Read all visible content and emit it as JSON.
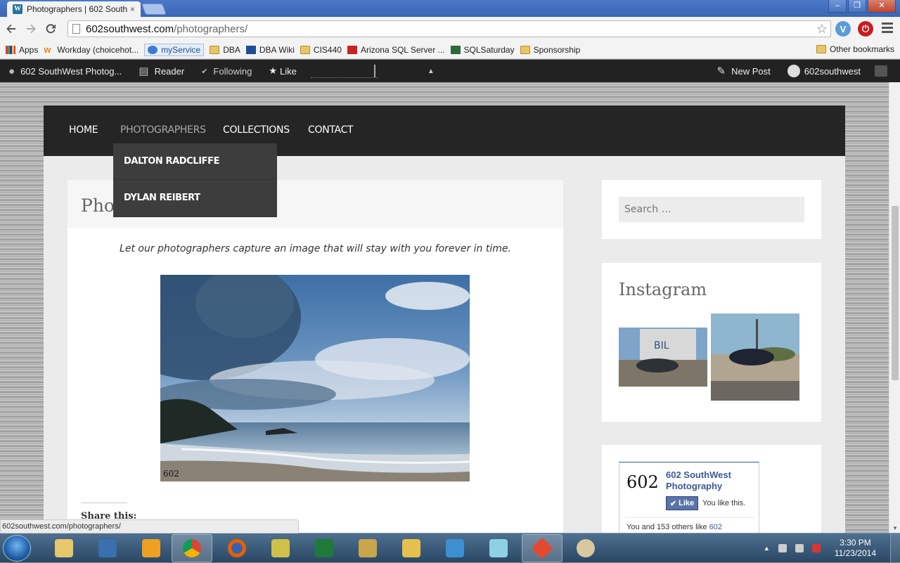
{
  "browser": {
    "tab_title": "Photographers | 602 South",
    "tab_close": "×",
    "url_domain": "602southwest.com",
    "url_path": "/photographers/",
    "status_url": "602southwest.com/photographers/",
    "window_buttons": [
      "–",
      "❐",
      "✕"
    ],
    "ext_blue": "V",
    "ext_red": "⏻"
  },
  "bookmarks": {
    "items": [
      {
        "label": "Apps",
        "icon": "apps-grid-icon"
      },
      {
        "label": "Workday (choicehot...",
        "icon": "workday-icon"
      },
      {
        "label": "myService",
        "icon": "myservice-icon"
      },
      {
        "label": "DBA",
        "icon": "folder-icon"
      },
      {
        "label": "DBA Wiki",
        "icon": "dba-wiki-icon"
      },
      {
        "label": "CIS440",
        "icon": "folder-icon"
      },
      {
        "label": "Arizona SQL Server ...",
        "icon": "arizona-sql-icon"
      },
      {
        "label": "SQLSaturday",
        "icon": "sqlsaturday-icon"
      },
      {
        "label": "Sponsorship",
        "icon": "folder-icon"
      }
    ],
    "other": "Other bookmarks"
  },
  "adminbar": {
    "site_name": "602 SouthWest Photog...",
    "reader": "Reader",
    "following": "Following",
    "like": "Like",
    "new_post": "New Post",
    "user": "602southwest"
  },
  "nav": {
    "items": [
      "HOME",
      "PHOTOGRAPHERS",
      "COLLECTIONS",
      "CONTACT"
    ],
    "dropdown": [
      "DALTON RADCLIFFE",
      "DYLAN REIBERT"
    ]
  },
  "content": {
    "title": "Photographers",
    "tagline": "Let our photographers capture an image that will stay with you forever in time.",
    "photo_watermark": "602",
    "share_label": "Share this:"
  },
  "sidebar": {
    "search_placeholder": "Search …",
    "instagram_title": "Instagram",
    "facebook": {
      "logo_text": "602",
      "page_name": "602 SouthWest Photography",
      "like_button": "Like",
      "you_like": "You like this.",
      "count_text": "You and 153 others like ",
      "count_link": "602"
    }
  },
  "taskbar": {
    "time": "3:30 PM",
    "date": "11/23/2014"
  },
  "colors": {
    "admin_bar": "#222222",
    "main_nav": "#252525",
    "dropdown": "#3d3d3d",
    "facebook_blue": "#3b5998"
  }
}
